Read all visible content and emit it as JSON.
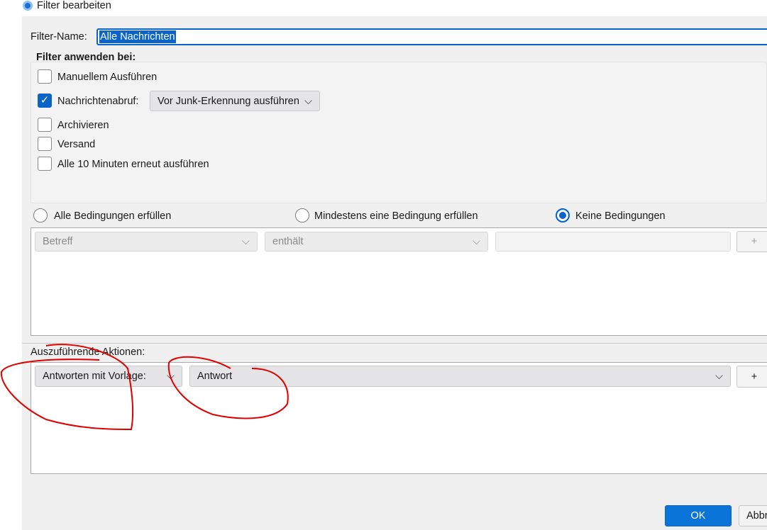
{
  "window": {
    "title": "Filter bearbeiten"
  },
  "filter_name": {
    "label": "Filter-Name:",
    "value": "Alle Nachrichten"
  },
  "apply": {
    "heading": "Filter anwenden bei:",
    "options": [
      {
        "label": "Manuellem Ausführen",
        "checked": false
      },
      {
        "label": "Nachrichtenabruf:",
        "checked": true
      },
      {
        "label": "Archivieren",
        "checked": false
      },
      {
        "label": "Versand",
        "checked": false
      },
      {
        "label": "Alle 10 Minuten erneut ausführen",
        "checked": false
      }
    ],
    "timing_select": "Vor Junk-Erkennung ausführen"
  },
  "match": {
    "options": [
      "Alle Bedingungen erfüllen",
      "Mindestens eine Bedingung erfüllen",
      "Keine Bedingungen"
    ],
    "selected": 2
  },
  "condition": {
    "field": "Betreff",
    "operator": "enthält",
    "value": "",
    "add": "+"
  },
  "actions": {
    "heading": "Auszuführende Aktionen:",
    "action": "Antworten mit Vorlage:",
    "template": "Antwort",
    "add": "+"
  },
  "buttons": {
    "ok": "OK",
    "cancel": "Abbr"
  },
  "annotation_color": "#e00000"
}
